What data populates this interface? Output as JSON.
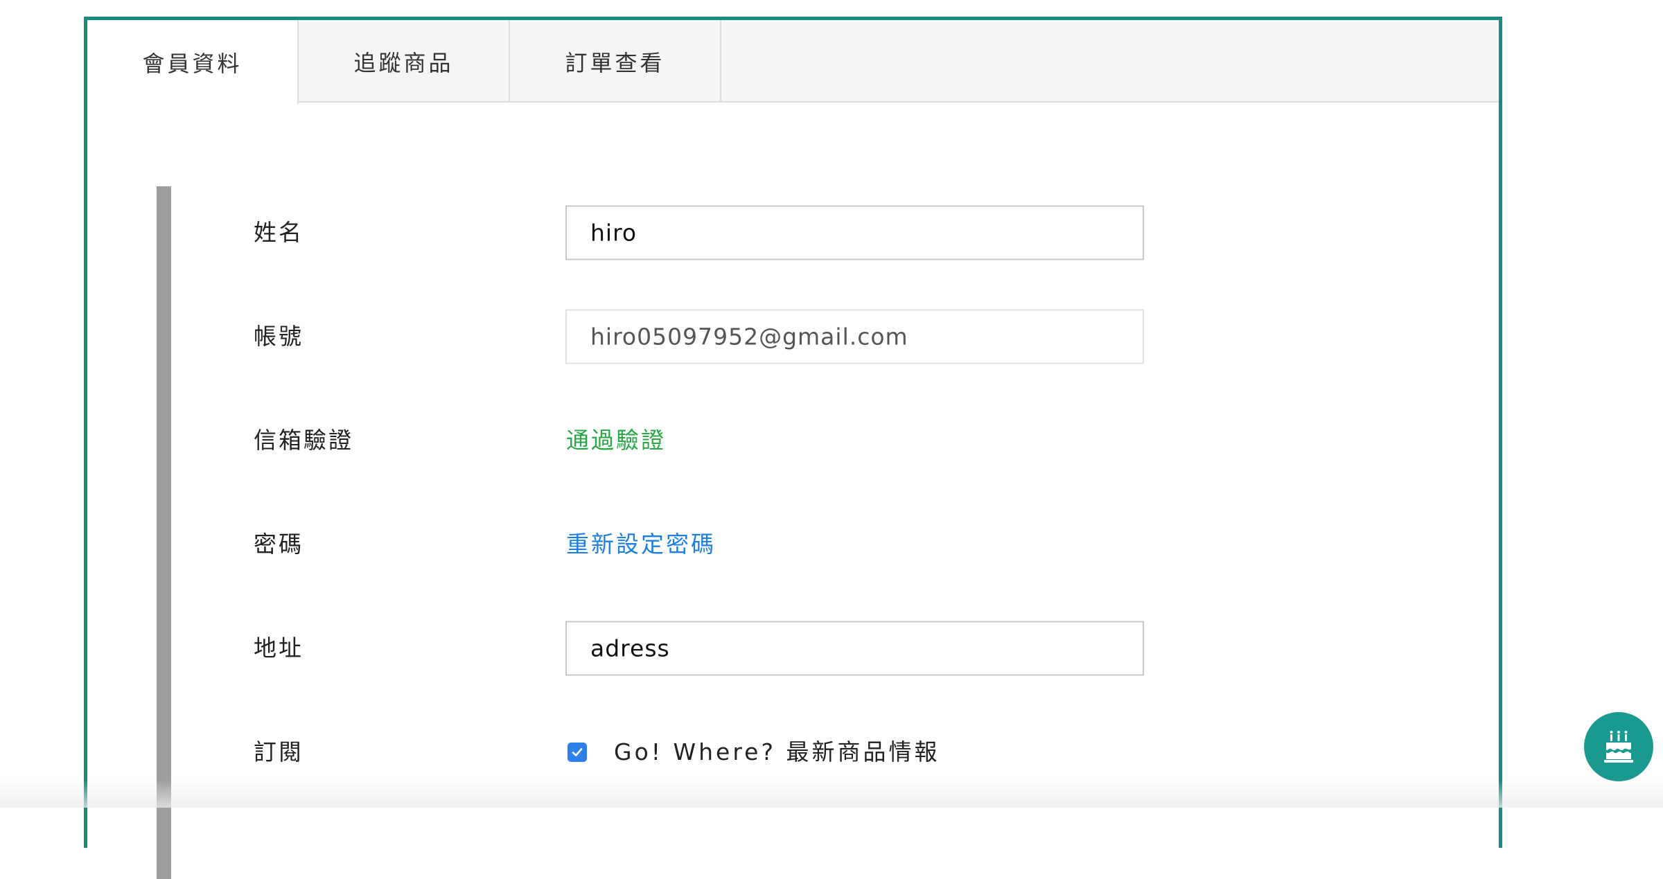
{
  "tabs": [
    {
      "label": "會員資料",
      "active": true
    },
    {
      "label": "追蹤商品",
      "active": false
    },
    {
      "label": "訂單查看",
      "active": false
    }
  ],
  "form": {
    "name_label": "姓名",
    "name_value": "hiro",
    "account_label": "帳號",
    "account_value": "hiro05097952@gmail.com",
    "email_verify_label": "信箱驗證",
    "email_verify_status": "通過驗證",
    "password_label": "密碼",
    "password_reset_link": "重新設定密碼",
    "address_label": "地址",
    "address_value": "adress",
    "subscribe_label": "訂閱",
    "subscribe_option": "Go! Where? 最新商品情報",
    "subscribe_checked": true
  },
  "colors": {
    "panel_border": "#1a8a80",
    "verified": "#28a745",
    "link": "#1e7fe0",
    "checkbox": "#2f7fe8",
    "fab": "#1a9990"
  },
  "icons": {
    "fab": "birthday-cake-icon",
    "checkbox": "checkmark-icon"
  }
}
